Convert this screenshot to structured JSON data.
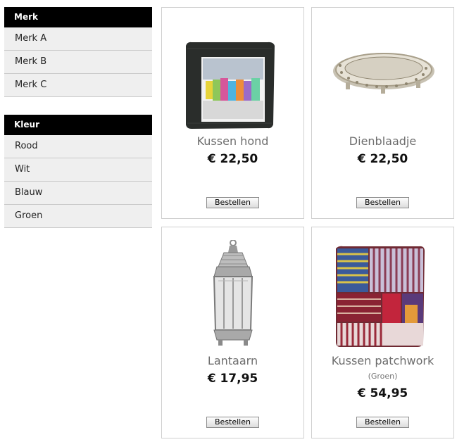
{
  "filters": [
    {
      "title": "Merk",
      "items": [
        "Merk A",
        "Merk B",
        "Merk C"
      ]
    },
    {
      "title": "Kleur",
      "items": [
        "Rood",
        "Wit",
        "Blauw",
        "Groen"
      ]
    }
  ],
  "products": [
    {
      "name": "Kussen hond",
      "price": "€ 22,50",
      "button": "Bestellen"
    },
    {
      "name": "Dienblaadje",
      "price": "€ 22,50",
      "button": "Bestellen"
    },
    {
      "name": "Lantaarn",
      "price": "€ 17,95",
      "button": "Bestellen"
    },
    {
      "name": "Kussen patchwork",
      "variant": "(Groen)",
      "price": "€ 54,95",
      "button": "Bestellen"
    }
  ]
}
